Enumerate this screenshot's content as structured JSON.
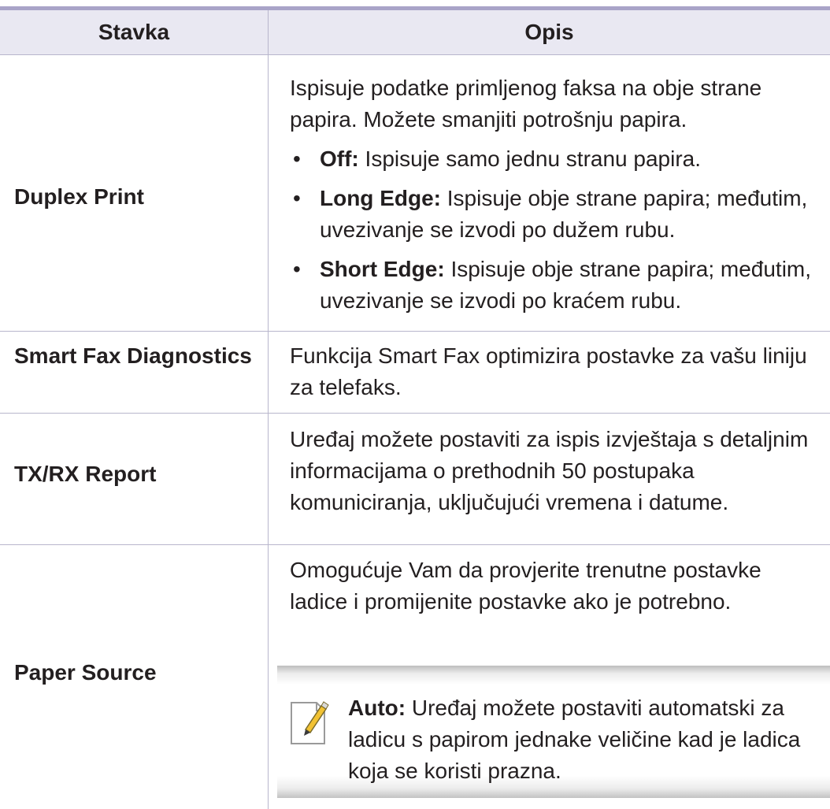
{
  "table": {
    "headers": {
      "item": "Stavka",
      "description": "Opis"
    },
    "rows": [
      {
        "item": "Duplex Print",
        "intro": "Ispisuje podatke primljenog faksa na obje strane papira. Možete smanjiti potrošnju papira.",
        "bullets": [
          {
            "term": "Off:",
            "text": " Ispisuje samo jednu stranu papira."
          },
          {
            "term": "Long Edge:",
            "text": " Ispisuje obje strane papira; međutim, uvezivanje se izvodi po dužem rubu."
          },
          {
            "term": "Short Edge:",
            "text": " Ispisuje obje strane papira; međutim, uvezivanje se izvodi po kraćem rubu."
          }
        ]
      },
      {
        "item": "Smart Fax Diagnostics",
        "description": "Funkcija Smart Fax optimizira postavke za vašu liniju za telefaks."
      },
      {
        "item": "TX/RX Report",
        "description": "Uređaj možete postaviti za ispis izvještaja s detaljnim informacijama o prethodnih 50 postupaka komuniciranja, uključujući vremena i datume."
      },
      {
        "item": "Paper Source",
        "description": "Omogućuje Vam da provjerite trenutne postavke ladice i promijenite postavke ako je potrebno.",
        "note": {
          "icon": "note-pencil-icon",
          "term": "Auto:",
          "text": " Uređaj možete postaviti automatski za ladicu s papirom jednake veličine kad je ladica koja se koristi prazna."
        }
      }
    ]
  }
}
